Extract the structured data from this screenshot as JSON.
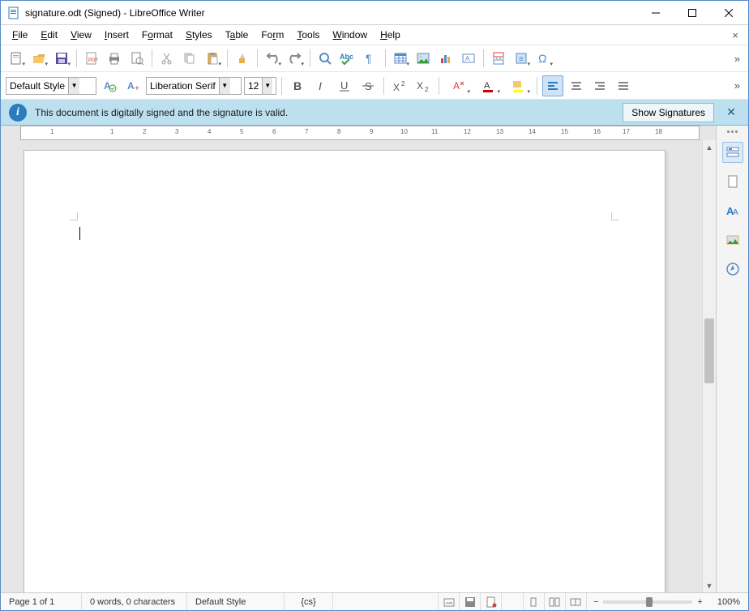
{
  "window": {
    "title": "signature.odt (Signed) - LibreOffice Writer"
  },
  "menu": {
    "file": "File",
    "edit": "Edit",
    "view": "View",
    "insert": "Insert",
    "format": "Format",
    "styles": "Styles",
    "table": "Table",
    "form": "Form",
    "tools": "Tools",
    "window": "Window",
    "help": "Help"
  },
  "format_bar": {
    "paragraph_style": "Default Style",
    "font_name": "Liberation Serif",
    "font_size": "12"
  },
  "infobar": {
    "message": "This document is digitally signed and the signature is valid.",
    "button": "Show Signatures"
  },
  "ruler": {
    "numbers": [
      "1",
      "1",
      "2",
      "3",
      "4",
      "5",
      "6",
      "7",
      "8",
      "9",
      "10",
      "11",
      "12",
      "13",
      "14",
      "15",
      "16",
      "17",
      "18"
    ]
  },
  "status": {
    "page": "Page 1 of 1",
    "words": "0 words, 0 characters",
    "style": "Default Style",
    "lang": "{cs}",
    "zoom": "100%"
  }
}
